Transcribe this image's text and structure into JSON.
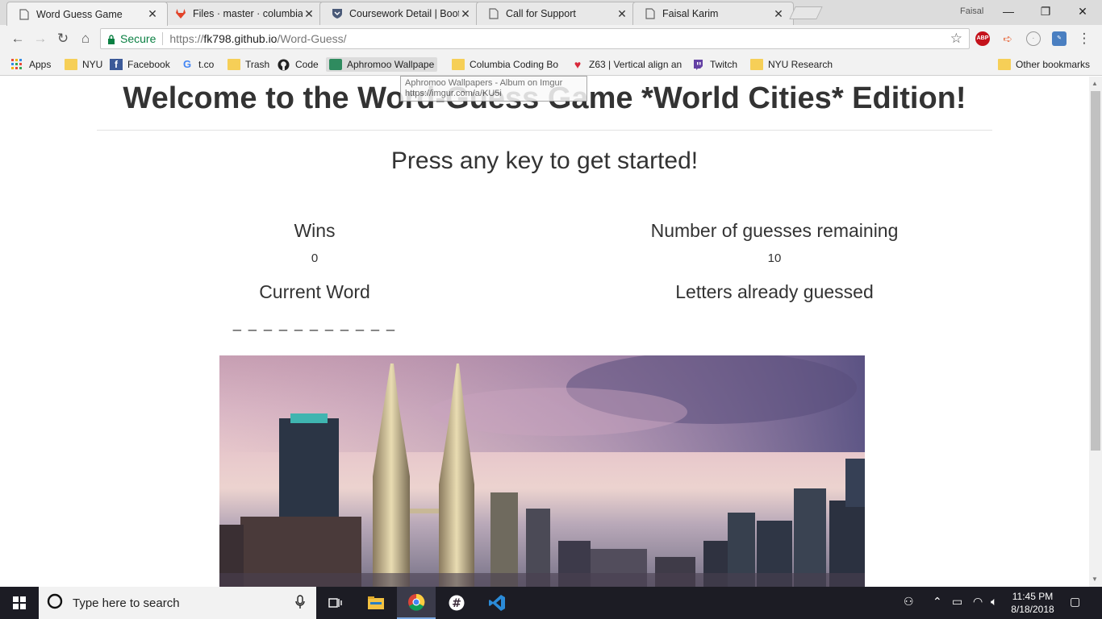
{
  "browser": {
    "tabs": [
      {
        "title": "Word Guess Game",
        "active": true,
        "favicon": "page-icon"
      },
      {
        "title": "Files · master · columbia-",
        "active": false,
        "favicon": "gitlab-icon"
      },
      {
        "title": "Coursework Detail | Boot",
        "active": false,
        "favicon": "shield-icon"
      },
      {
        "title": "Call for Support",
        "active": false,
        "favicon": "page-icon"
      },
      {
        "title": "Faisal Karim",
        "active": false,
        "favicon": "page-icon"
      }
    ],
    "profile_name": "Faisal",
    "secure_label": "Secure",
    "url_scheme": "https://",
    "url_host": "fk798.github.io",
    "url_path": "/Word-Guess/",
    "bookmarks": [
      {
        "label": "Apps",
        "icon": "apps-grid-icon"
      },
      {
        "label": "NYU",
        "icon": "folder-icon"
      },
      {
        "label": "Facebook",
        "icon": "facebook-icon"
      },
      {
        "label": "t.co",
        "icon": "google-icon"
      },
      {
        "label": "Trash",
        "icon": "folder-icon"
      },
      {
        "label": "Code",
        "icon": "github-icon"
      },
      {
        "label": "Aphromoo Wallpape",
        "icon": "site-icon"
      },
      {
        "label": "Columbia Coding Bo",
        "icon": "folder-icon"
      },
      {
        "label": "Z63 | Vertical align an",
        "icon": "heart-icon"
      },
      {
        "label": "Twitch",
        "icon": "twitch-icon"
      },
      {
        "label": "NYU Research",
        "icon": "folder-icon"
      },
      {
        "label": "Other bookmarks",
        "icon": "folder-icon"
      }
    ],
    "tooltip_line1": "Aphromoo Wallpapers - Album on Imgur",
    "tooltip_line2": "https://imgur.com/a/KU5i"
  },
  "page": {
    "headline": "Welcome to the Word-Guess Game *World Cities* Edition!",
    "subtitle": "Press any key to get started!",
    "wins_label": "Wins",
    "wins_value": "0",
    "guesses_label": "Number of guesses remaining",
    "guesses_value": "10",
    "current_word_label": "Current Word",
    "current_word_value": "_ _ _ _ _ _ _ _ _ _ _",
    "letters_label": "Letters already guessed",
    "letters_value": ""
  },
  "taskbar": {
    "search_placeholder": "Type here to search",
    "time": "11:45 PM",
    "date": "8/18/2018"
  },
  "colors": {
    "text": "#333333",
    "secure_green": "#0b8043",
    "taskbar": "#1c1c24"
  }
}
